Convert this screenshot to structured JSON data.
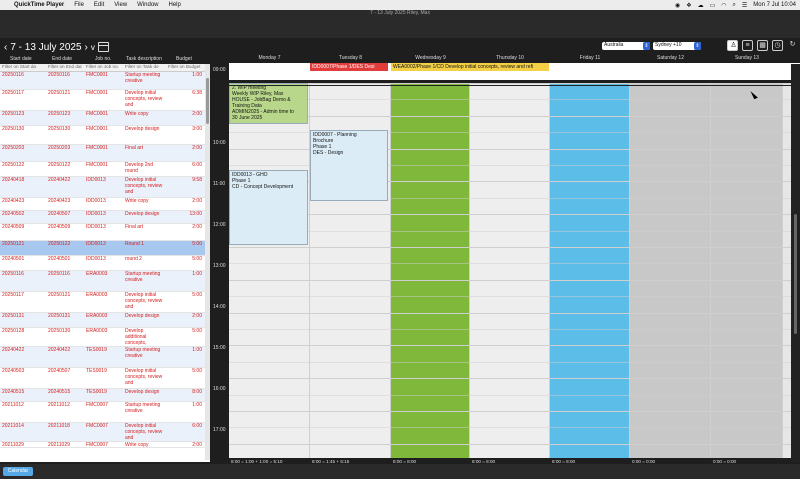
{
  "menubar": {
    "app": "QuickTime Player",
    "items": [
      "File",
      "Edit",
      "View",
      "Window",
      "Help"
    ],
    "time": "Mon 7 Jul 10:04"
  },
  "window": {
    "title": "7 - 13 July 2025  Riley, Max"
  },
  "nav": {
    "range": "7 - 13 July 2025",
    "prev": "‹",
    "next": "›",
    "view": "v"
  },
  "selects": {
    "country": "Australia",
    "timezone": "Sydney +10"
  },
  "table": {
    "headers": [
      "Start date",
      "End date",
      "Job no.",
      "Task description",
      "Budget"
    ],
    "filters": [
      "Filter on Start da",
      "Filter on End dat",
      "Filter on Job no.",
      "Filter on Task de",
      "Filter on Budget"
    ],
    "rows": [
      {
        "start": "20250116",
        "end": "20250116",
        "job": "FMC0001",
        "task": "Startup meeting creative",
        "budget": "1:00"
      },
      {
        "start": "20250117",
        "end": "20250121",
        "job": "FMC0001",
        "task": "Develop initial concepts, review and",
        "budget": "6:38"
      },
      {
        "start": "20250123",
        "end": "20250123",
        "job": "FMC0001",
        "task": "Write copy",
        "budget": "2:00"
      },
      {
        "start": "20250130",
        "end": "20250130",
        "job": "FMC0001",
        "task": "Develop design",
        "budget": "3:00"
      },
      {
        "start": "20250203",
        "end": "20250203",
        "job": "FMC0001",
        "task": "Final art",
        "budget": "2:00"
      },
      {
        "start": "20250122",
        "end": "20250122",
        "job": "FMC0001",
        "task": "Develop 2nd round",
        "budget": "6:00"
      },
      {
        "start": "20240418",
        "end": "20240422",
        "job": "IDD0013",
        "task": "Develop initial concepts, review and",
        "budget": "9:58"
      },
      {
        "start": "20240423",
        "end": "20240423",
        "job": "IDD0013",
        "task": "Write copy",
        "budget": "2:00"
      },
      {
        "start": "20240502",
        "end": "20240507",
        "job": "IDD0013",
        "task": "Develop design",
        "budget": "13:00"
      },
      {
        "start": "20240509",
        "end": "20240509",
        "job": "IDD0013",
        "task": "Final art",
        "budget": "2:00"
      },
      {
        "start": "20250121",
        "end": "20250122",
        "job": "IDD0013",
        "task": "Round 1",
        "budget": "5:00"
      },
      {
        "start": "20240501",
        "end": "20240501",
        "job": "IDD0013",
        "task": "round 2",
        "budget": "5:00"
      },
      {
        "start": "20250116",
        "end": "20250116",
        "job": "ERA0003",
        "task": "Startup meeting creative",
        "budget": "1:00"
      },
      {
        "start": "20250117",
        "end": "20250121",
        "job": "ERA0003",
        "task": "Develop initial concepts, review and",
        "budget": "5:00"
      },
      {
        "start": "20250131",
        "end": "20250131",
        "job": "ERA0003",
        "task": "Develop design",
        "budget": "2:00"
      },
      {
        "start": "20250128",
        "end": "20250130",
        "job": "ERA0003",
        "task": "Develop additional concepts,",
        "budget": "5:00"
      },
      {
        "start": "20240422",
        "end": "20240422",
        "job": "TES0019",
        "task": "Startup meeting creative",
        "budget": "1:00"
      },
      {
        "start": "20240503",
        "end": "20240507",
        "job": "TES0019",
        "task": "Develop initial concepts, review and",
        "budget": "5:00"
      },
      {
        "start": "20240515",
        "end": "20240515",
        "job": "TES0019",
        "task": "Develop design",
        "budget": "8:00"
      },
      {
        "start": "20211012",
        "end": "20211012",
        "job": "FMC0007",
        "task": "Startup meeting creative",
        "budget": "1:00"
      },
      {
        "start": "20211014",
        "end": "20211018",
        "job": "FMC0007",
        "task": "Develop initial concepts, review and",
        "budget": "6:00"
      },
      {
        "start": "20211029",
        "end": "20211029",
        "job": "FMC0007",
        "task": "Write copy",
        "budget": "2:00"
      }
    ]
  },
  "calendar": {
    "days": [
      "Monday 7",
      "Tuesday 8",
      "Wednesday 9",
      "Thursday 10",
      "Friday 11",
      "Saturday 12",
      "Sunday 13"
    ],
    "day_colors": [
      "#eeeeee",
      "#eeeeee",
      "#7fb83a",
      "#eeeeee",
      "#5cbde8",
      "#c8c8c8",
      "#c8c8c8"
    ],
    "hours": [
      "09:00",
      "10:00",
      "11:00",
      "12:00",
      "13:00",
      "14:00",
      "15:00",
      "16:00",
      "17:00"
    ],
    "allday_events": [
      {
        "label": "IDD0007/Phase 1/DES Desi",
        "color": "#e23b3b",
        "text_color": "#ffffff"
      },
      {
        "label": "WEA0002/Phase 1/CD Develop initial concepts, review and refi",
        "color": "#f3d046",
        "text_color": "#111111"
      }
    ],
    "events": [
      {
        "label": "2. WIP meeting\nWeekly WIP Riley, Max\nHOUSE - JobBag Demo &\nTraining Data\nADMIN2025 - Admin time to\n30 June 2025",
        "color": "#b9d78a"
      },
      {
        "label": "IDD0007 - Planning\nBrochure\nPhase 1\nDES - Design",
        "color": "#dcecf7"
      },
      {
        "label": "IDD0013 - GHO\nPhase 1\nCD - Concept Development",
        "color": "#dcecf7"
      }
    ],
    "totals": [
      {
        "text": "8:00 = 1:00 + 1:00 = 5:10"
      },
      {
        "text": "8:00 = 1:45 + 6:15"
      },
      {
        "text": "8:00 = 8:00"
      },
      {
        "text": "8:00 = 8:00"
      },
      {
        "text": "8:00 = 8:00"
      },
      {
        "text": "0:00 = 0:00"
      },
      {
        "text": "0:00 = 0:00"
      }
    ]
  },
  "bottom": {
    "tab": "Calendar"
  }
}
